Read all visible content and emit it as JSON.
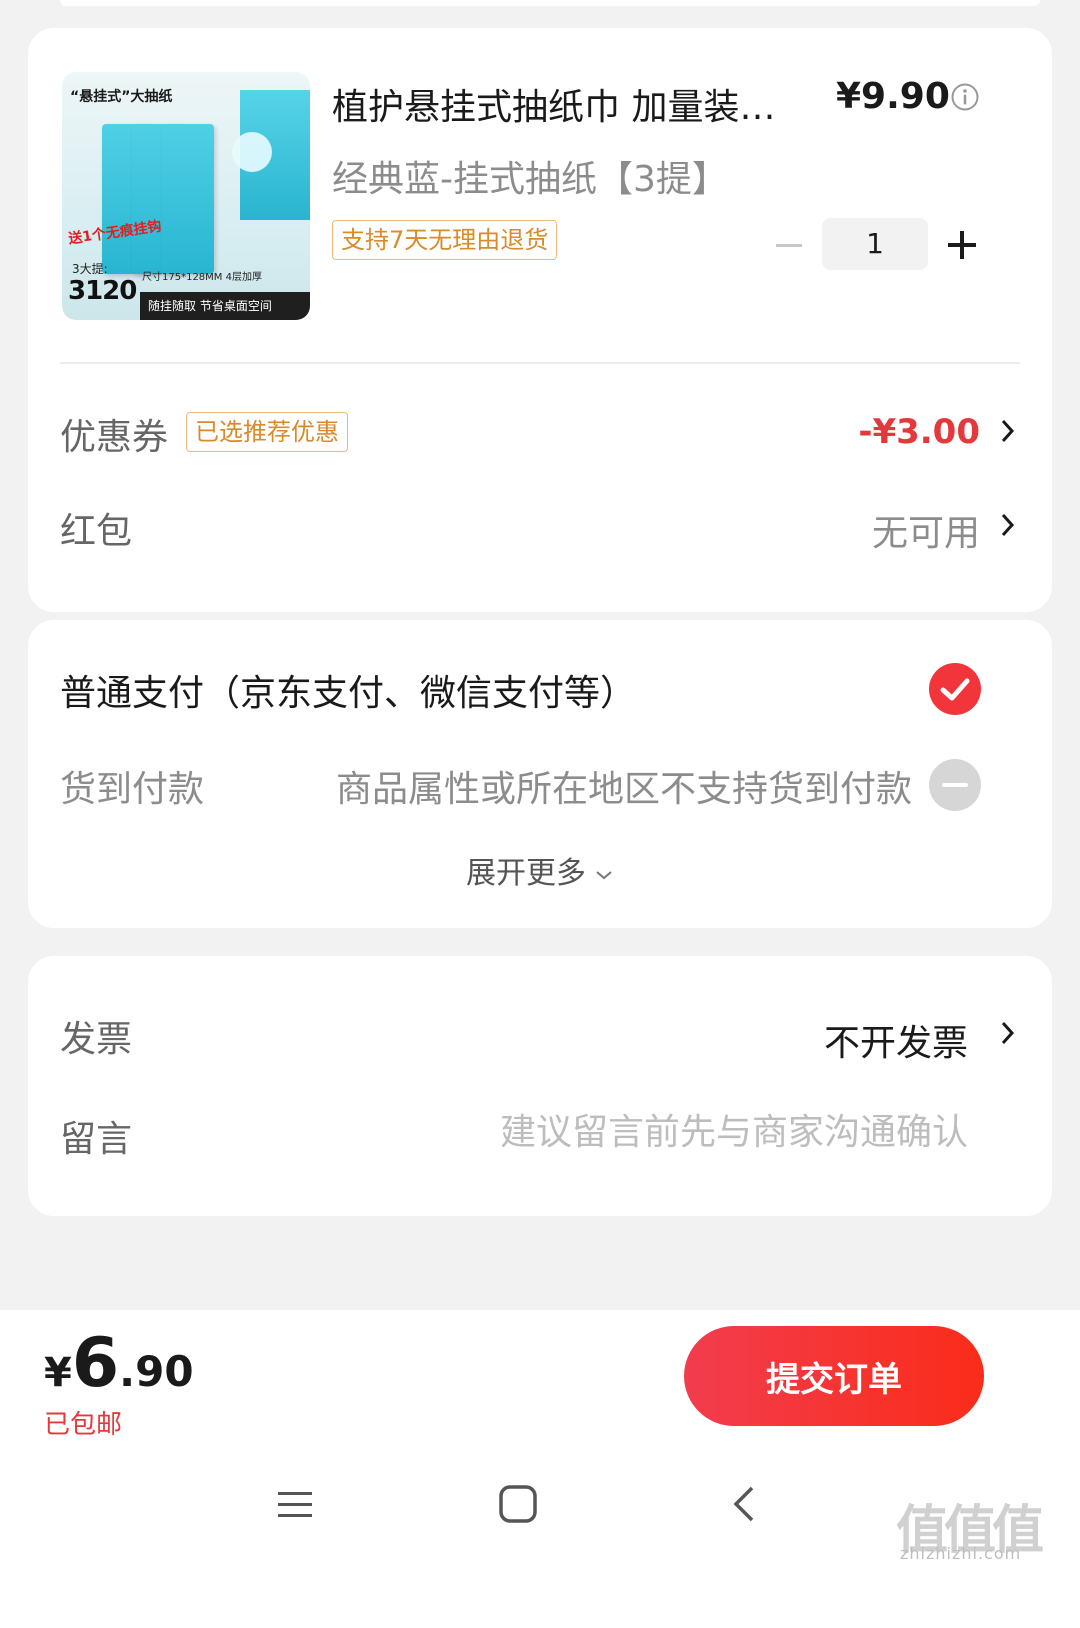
{
  "product": {
    "title": "植护悬挂式抽纸巾 加量装…",
    "price": "¥9.90",
    "variant": "经典蓝-挂式抽纸【3提】",
    "return_policy": "支持7天无理由退货",
    "quantity": "1",
    "image": {
      "title": "“悬挂式”大抽纸",
      "promo": "送1个无痕挂钩",
      "count_label": "3大提:",
      "count": "3120",
      "size": "尺寸175*128MM 4层加厚",
      "bar": "随挂随取 节省桌面空间"
    }
  },
  "coupon": {
    "label": "优惠券",
    "badge": "已选推荐优惠",
    "value": "-¥3.00"
  },
  "red_packet": {
    "label": "红包",
    "value": "无可用"
  },
  "payment": {
    "normal": "普通支付（京东支付、微信支付等）",
    "cod_label": "货到付款",
    "cod_note": "商品属性或所在地区不支持货到付款",
    "expand": "展开更多"
  },
  "invoice": {
    "label": "发票",
    "value": "不开发票"
  },
  "message": {
    "label": "留言",
    "placeholder": "建议留言前先与商家沟通确认"
  },
  "footer": {
    "currency": "¥",
    "total_int": "6",
    "total_dec": ".90",
    "shipping": "已包邮",
    "submit": "提交订单"
  },
  "watermark": {
    "logo": "值值值",
    "site": "zhizhizhi.com"
  },
  "colors": {
    "accent": "#e4393c",
    "badge": "#d98a2b",
    "submit_start": "#f23d4e",
    "submit_end": "#fa2c19"
  }
}
